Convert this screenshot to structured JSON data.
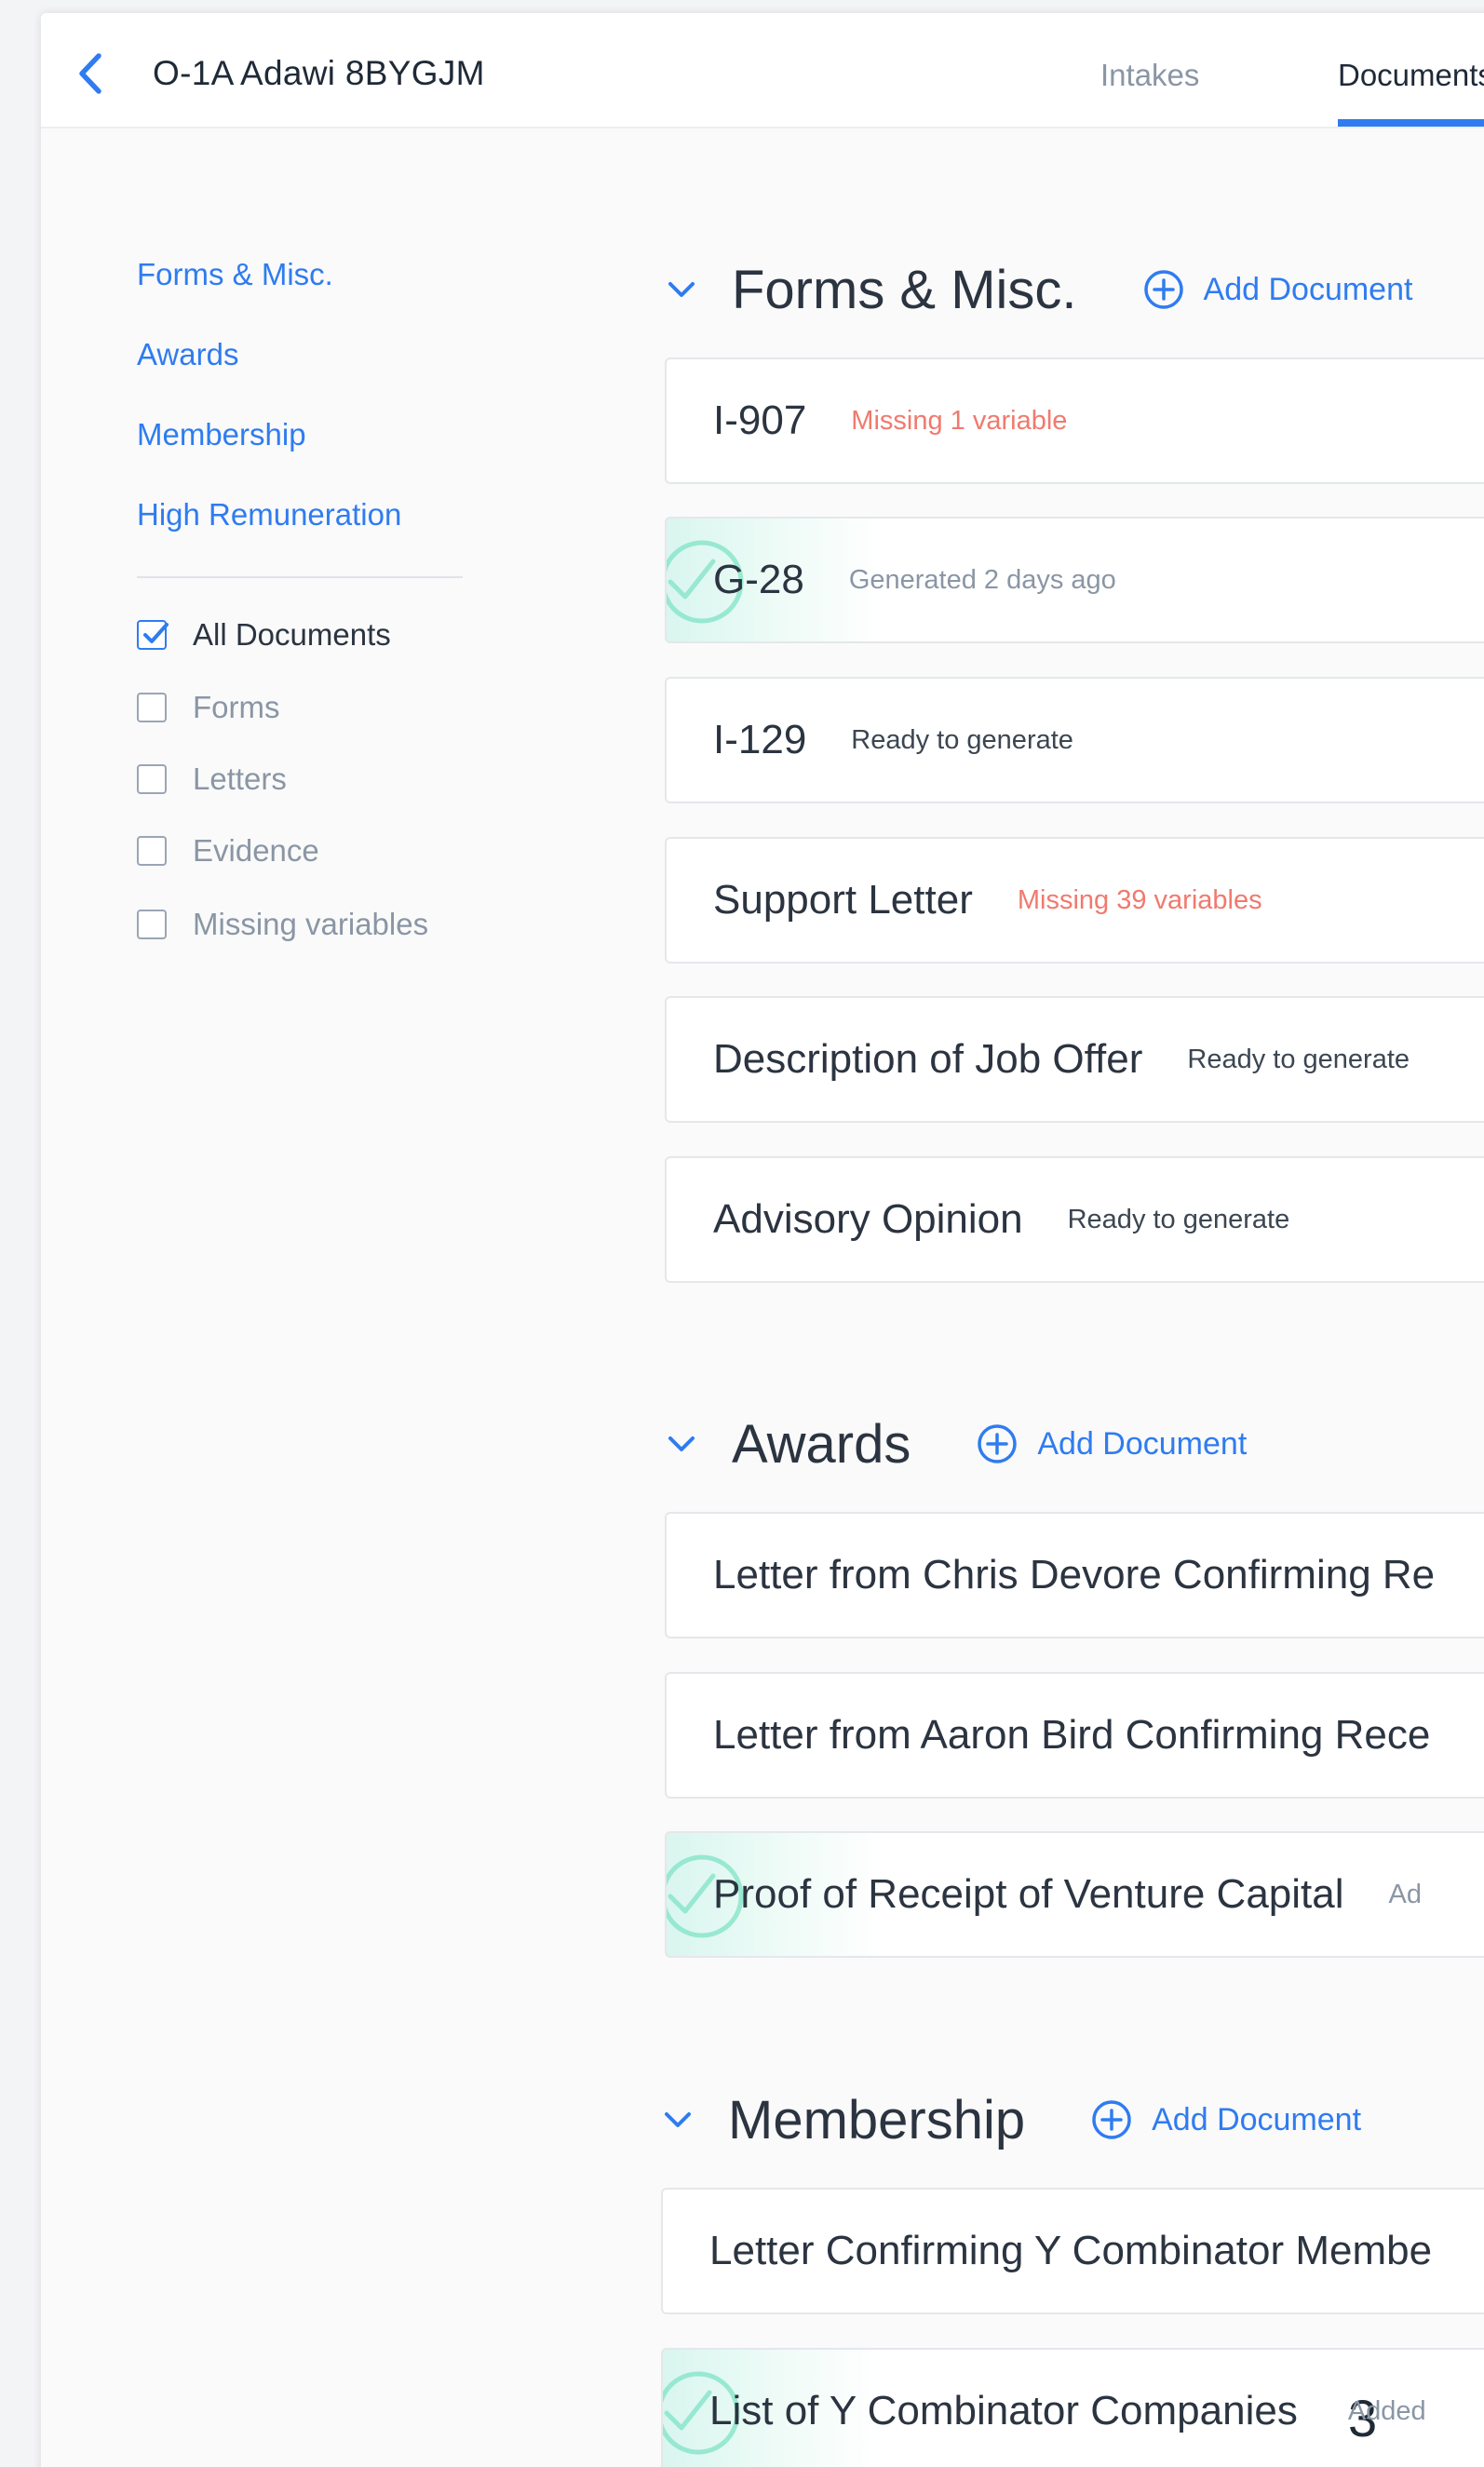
{
  "header": {
    "title": "O-1A Adawi 8BYGJM",
    "tabs": [
      {
        "label": "Intakes"
      },
      {
        "label": "Documents"
      }
    ]
  },
  "sidebar": {
    "links": [
      {
        "label": "Forms & Misc."
      },
      {
        "label": "Awards"
      },
      {
        "label": "Membership"
      },
      {
        "label": "High Remuneration"
      }
    ],
    "filters": [
      {
        "label": "All Documents",
        "checked": true
      },
      {
        "label": "Forms",
        "checked": false
      },
      {
        "label": "Letters",
        "checked": false
      },
      {
        "label": "Evidence",
        "checked": false
      },
      {
        "label": "Missing variables",
        "checked": false
      }
    ]
  },
  "add_document_label": "Add Document",
  "sections": [
    {
      "title": "Forms & Misc.",
      "documents": [
        {
          "title": "I-907",
          "status": "Missing 1 variable"
        },
        {
          "title": "G-28",
          "status": "Generated 2 days ago"
        },
        {
          "title": "I-129",
          "status": "Ready to generate"
        },
        {
          "title": "Support Letter",
          "status": "Missing 39 variables"
        },
        {
          "title": "Description of Job Offer",
          "status": "Ready to generate"
        },
        {
          "title": "Advisory Opinion",
          "status": "Ready to generate"
        }
      ]
    },
    {
      "title": "Awards",
      "documents": [
        {
          "title": "Letter from Chris Devore Confirming Re",
          "status": ""
        },
        {
          "title": "Letter from Aaron Bird Confirming Rece",
          "status": ""
        },
        {
          "title": "Proof of Receipt of Venture Capital",
          "status": "Ad"
        }
      ]
    },
    {
      "title": "Membership",
      "documents": [
        {
          "title": "Letter Confirming Y Combinator Membe",
          "status": ""
        },
        {
          "title": "List of Y Combinator Companies",
          "status": "Added"
        }
      ]
    }
  ],
  "page_number": "3",
  "colors": {
    "accent": "#2f7cf0",
    "warning": "#f07a6e",
    "muted": "#8a96a5",
    "success": "#4fd1b0"
  }
}
